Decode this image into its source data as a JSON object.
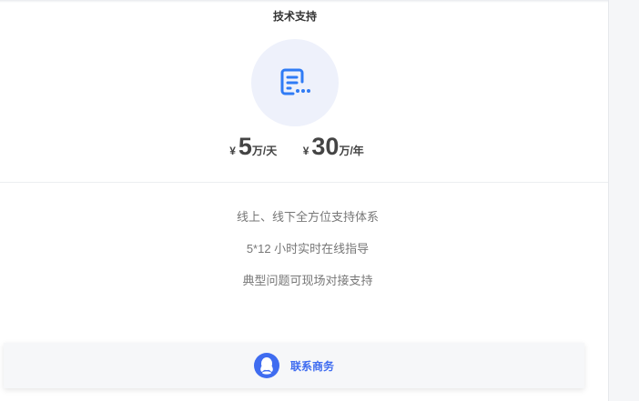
{
  "card": {
    "title": "技术支持",
    "icon": "document-list-icon",
    "prices": [
      {
        "symbol": "¥",
        "amount": "5",
        "unit": "万/天"
      },
      {
        "symbol": "¥",
        "amount": "30",
        "unit": "万/年"
      }
    ],
    "features": [
      "线上、线下全方位支持体系",
      "5*12 小时实时在线指导",
      "典型问题可现场对接支持"
    ],
    "contact": {
      "icon": "qq-icon",
      "label": "联系商务"
    }
  },
  "colors": {
    "accent": "#3f6cf0",
    "icon_bg": "#eef1fb"
  }
}
